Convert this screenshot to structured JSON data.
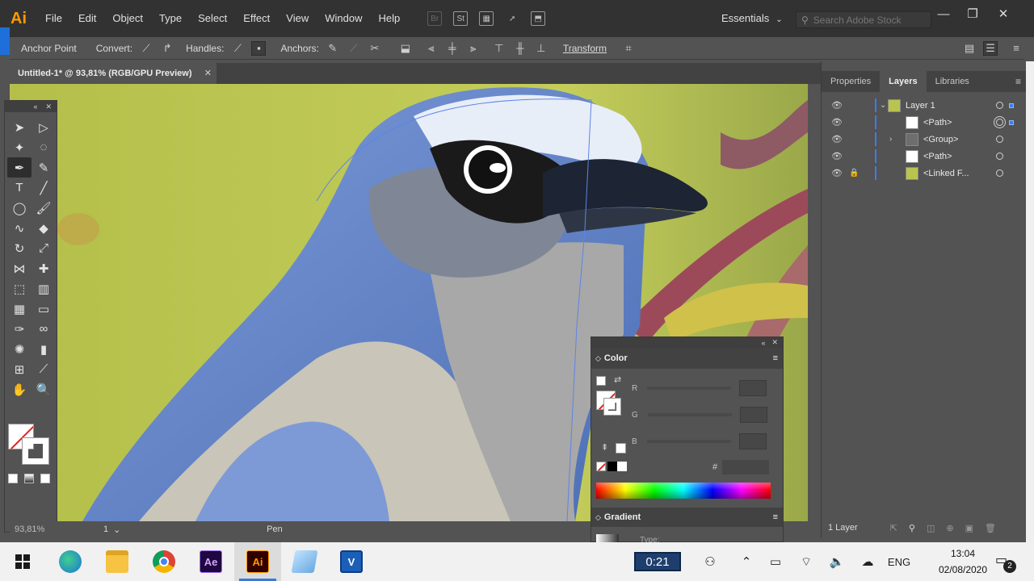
{
  "app": {
    "logo": "Ai",
    "accent": "#ff9a00"
  },
  "menu": [
    "File",
    "Edit",
    "Object",
    "Type",
    "Select",
    "Effect",
    "View",
    "Window",
    "Help"
  ],
  "menu_icons": [
    "Br",
    "St",
    "arrange-icon",
    "gpu-rocket-icon",
    "bridge-icon"
  ],
  "workspace": {
    "label": "Essentials"
  },
  "search": {
    "placeholder": "Search Adobe Stock"
  },
  "window_controls": [
    "minimize-icon",
    "restore-icon",
    "close-icon"
  ],
  "controlbar": {
    "anchor_point": "Anchor Point",
    "convert": "Convert:",
    "handles": "Handles:",
    "anchors": "Anchors:",
    "transform": "Transform"
  },
  "document": {
    "tab_title": "Untitled-1* @ 93,81% (RGB/GPU Preview)"
  },
  "statusbar": {
    "zoom": "93,81%",
    "page": "1",
    "tool": "Pen"
  },
  "panels": {
    "tabs": [
      "Properties",
      "Layers",
      "Libraries"
    ],
    "active_tab": "Layers",
    "layers": [
      {
        "name": "Layer 1",
        "level": 0,
        "expanded": true,
        "locked": false,
        "thumb": "green"
      },
      {
        "name": "<Path>",
        "level": 1,
        "locked": false,
        "thumb": "white",
        "selected": true
      },
      {
        "name": "<Group>",
        "level": 1,
        "collapsed": true,
        "locked": false,
        "thumb": "dark"
      },
      {
        "name": "<Path>",
        "level": 1,
        "locked": false,
        "thumb": "white"
      },
      {
        "name": "<Linked F...",
        "level": 1,
        "locked": true,
        "thumb": "green"
      }
    ],
    "footer_count": "1 Layer"
  },
  "color_panel": {
    "title": "Color",
    "channels": [
      "R",
      "G",
      "B"
    ],
    "hex_label": "#",
    "gradient_title": "Gradient",
    "gradient_type_label": "Type:"
  },
  "taskbar": {
    "apps": [
      "edge-icon",
      "file-explorer-icon",
      "chrome-icon",
      "after-effects-icon",
      "illustrator-icon",
      "generic-app-icon",
      "visio-icon"
    ],
    "ae_label": "Ae",
    "ai_label": "Ai",
    "v_label": "V",
    "timer": "0:21",
    "language": "ENG",
    "time": "13:04",
    "date": "02/08/2020",
    "notifications": "2"
  }
}
